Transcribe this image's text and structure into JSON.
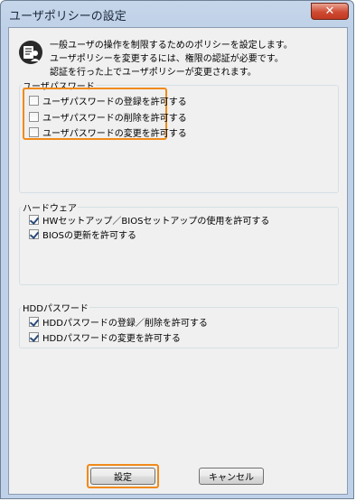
{
  "window": {
    "title": "ユーザポリシーの設定",
    "close_glyph": "✕"
  },
  "description": {
    "line1": "一般ユーザの操作を制限するためのポリシーを設定します。",
    "line2": "ユーザポリシーを変更するには、権限の認証が必要です。",
    "line3": "認証を行った上でユーザポリシーが変更されます。"
  },
  "groups": {
    "user_password": {
      "label": "ユーザパスワード",
      "items": [
        {
          "label": "ユーザパスワードの登録を許可する",
          "checked": false
        },
        {
          "label": "ユーザパスワードの削除を許可する",
          "checked": false
        },
        {
          "label": "ユーザパスワードの変更を許可する",
          "checked": false
        }
      ]
    },
    "hardware": {
      "label": "ハードウェア",
      "items": [
        {
          "label": "HWセットアップ／BIOSセットアップの使用を許可する",
          "checked": true
        },
        {
          "label": "BIOSの更新を許可する",
          "checked": true
        }
      ]
    },
    "hdd_password": {
      "label": "HDDパスワード",
      "items": [
        {
          "label": "HDDパスワードの登録／削除を許可する",
          "checked": true
        },
        {
          "label": "HDDパスワードの変更を許可する",
          "checked": true
        }
      ]
    }
  },
  "buttons": {
    "ok": "設定",
    "cancel": "キャンセル"
  },
  "colors": {
    "highlight": "#f08a1a",
    "titlebar": "#c6d6ea",
    "close": "#cf4a32"
  }
}
